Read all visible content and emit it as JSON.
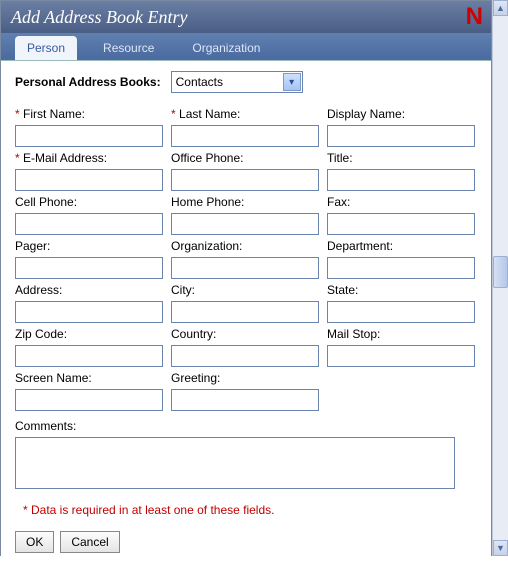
{
  "title": "Add Address Book Entry",
  "logo_letter": "N",
  "tabs": [
    "Person",
    "Resource",
    "Organization"
  ],
  "active_tab": "Person",
  "addrbook_label": "Personal Address Books:",
  "addrbook_selected": "Contacts",
  "fields": {
    "first_name": {
      "label": "First Name:",
      "required": true,
      "value": ""
    },
    "last_name": {
      "label": "Last Name:",
      "required": true,
      "value": ""
    },
    "display_name": {
      "label": "Display Name:",
      "required": false,
      "value": ""
    },
    "email": {
      "label": "E-Mail Address:",
      "required": true,
      "value": ""
    },
    "office_phone": {
      "label": "Office Phone:",
      "required": false,
      "value": ""
    },
    "title": {
      "label": "Title:",
      "required": false,
      "value": ""
    },
    "cell_phone": {
      "label": "Cell Phone:",
      "required": false,
      "value": ""
    },
    "home_phone": {
      "label": "Home Phone:",
      "required": false,
      "value": ""
    },
    "fax": {
      "label": "Fax:",
      "required": false,
      "value": ""
    },
    "pager": {
      "label": "Pager:",
      "required": false,
      "value": ""
    },
    "organization": {
      "label": "Organization:",
      "required": false,
      "value": ""
    },
    "department": {
      "label": "Department:",
      "required": false,
      "value": ""
    },
    "address": {
      "label": "Address:",
      "required": false,
      "value": ""
    },
    "city": {
      "label": "City:",
      "required": false,
      "value": ""
    },
    "state": {
      "label": "State:",
      "required": false,
      "value": ""
    },
    "zip": {
      "label": "Zip Code:",
      "required": false,
      "value": ""
    },
    "country": {
      "label": "Country:",
      "required": false,
      "value": ""
    },
    "mail_stop": {
      "label": "Mail Stop:",
      "required": false,
      "value": ""
    },
    "screen_name": {
      "label": "Screen Name:",
      "required": false,
      "value": ""
    },
    "greeting": {
      "label": "Greeting:",
      "required": false,
      "value": ""
    },
    "comments": {
      "label": "Comments:",
      "required": false,
      "value": ""
    }
  },
  "footnote": "* Data is required in at least one of these fields.",
  "buttons": {
    "ok": "OK",
    "cancel": "Cancel"
  }
}
